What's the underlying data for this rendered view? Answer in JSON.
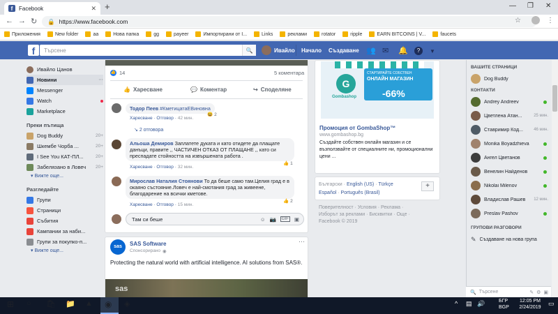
{
  "browser": {
    "tab_title": "Facebook",
    "url": "https://www.facebook.com",
    "bookmarks": [
      "Приложения",
      "New folder",
      "аа",
      "Нова папка",
      "gg",
      "payeer",
      "Импортирани от I...",
      "Links",
      "реклами",
      "rotator",
      "ripple",
      "EARN BITCOINS | V...",
      "faucets"
    ]
  },
  "fb": {
    "search_placeholder": "Търсене",
    "user_name": "Ивайло",
    "home": "Начало",
    "create": "Създаване"
  },
  "left": {
    "profile": "Ивайло Цанов",
    "main_items": [
      {
        "label": "Новини",
        "color": "#4267b2"
      },
      {
        "label": "Messenger",
        "color": "#0084ff"
      },
      {
        "label": "Watch",
        "color": "#3578e5"
      },
      {
        "label": "Marketplace",
        "color": "#1ba39c"
      }
    ],
    "shortcuts_title": "Преки пътища",
    "shortcuts": [
      {
        "label": "Dog Buddy",
        "count": "20+"
      },
      {
        "label": "Шкембе Чорба ...",
        "count": "20+"
      },
      {
        "label": "I See You КАТ-ПЛ...",
        "count": "20+"
      },
      {
        "label": "Забелязано в Ловеч",
        "count": "20+"
      }
    ],
    "more1": "Вижте още...",
    "explore_title": "Разгледайте",
    "explore": [
      {
        "label": "Групи",
        "color": "#3578e5"
      },
      {
        "label": "Страници",
        "color": "#f7533e"
      },
      {
        "label": "Събития",
        "color": "#e9443a"
      },
      {
        "label": "Кампании за наби...",
        "color": "#e9443a"
      },
      {
        "label": "Групи за покупко-п...",
        "color": "#8a8d91"
      }
    ],
    "more2": "Вижте още..."
  },
  "post": {
    "likes": "14",
    "comments_count": "5 коментара",
    "like_btn": "Харесване",
    "comment_btn": "Коментар",
    "share_btn": "Споделяне",
    "comments": [
      {
        "author": "Тодор Пеев",
        "text": "#КметицатаЕВиновна",
        "react_count": "2",
        "like": "Харесване",
        "reply": "Отговор",
        "time": "42 мин.",
        "replies": "2 отговора"
      },
      {
        "author": "Альоша Демиров",
        "text": "Заплатете дуката и като отидете да плащате данъци, правите ,, ЧАСТИЧЕН ОТКАЗ ОТ ПЛАЩАНЕ ,, като си преспадате стойността на извършената работа .",
        "react_count": "1",
        "like": "Харесване",
        "reply": "Отговор",
        "time": "32 мин."
      },
      {
        "author": "Мирослав Наталия Стоянови",
        "text": "То да беше само там.Целия град е в окаяно състояние.Ловеч е най-смотания град за живеене, благодарение на всички кметове.",
        "react_count": "2",
        "like": "Харесване",
        "reply": "Отговор",
        "time": "15 мин."
      }
    ],
    "comment_input": "Там си беше"
  },
  "sponsored": {
    "name": "SAS Software",
    "label": "Спонсорирано",
    "text": "Protecting the natural world with artificial intelligence. AI solutions from SAS®.",
    "logo": "sas"
  },
  "ad": {
    "title": "Промоция от GombaShop™",
    "domain": "www.gombashop.bg",
    "desc": "Създайте собствен онлайн магазин и се възползвайте от специалните ни, промоционални цени ...",
    "banner_top": "СТАРТИРАЙТЕ СОБСТВЕН",
    "banner_main": "ОНЛАЙН МАГАЗИН",
    "banner_discount": "-66%",
    "banner_brand": "Gombashop"
  },
  "langs": {
    "items": [
      "Български",
      "English (US)",
      "Türkçe",
      "Español",
      "Português (Brasil)"
    ]
  },
  "footer": {
    "line1": "Поверителност · Условия · Реклама ·",
    "line2": "Изборът за реклами · Бисквитки · Още ·",
    "line3": "Facebook © 2019"
  },
  "chat": {
    "your_pages": "ВАШИТЕ СТРАНИЦИ",
    "page": "Dog Buddy",
    "contacts": "КОНТАКТИ",
    "people": [
      {
        "name": "Andrey Andreev",
        "status": "online"
      },
      {
        "name": "Цветлена Атан...",
        "status": "25 мин."
      },
      {
        "name": "Ставримир Код...",
        "status": "46 мин."
      },
      {
        "name": "Monika Boyadzhieva",
        "status": "online"
      },
      {
        "name": "Ангел Цветанов",
        "status": "online"
      },
      {
        "name": "Венелин Найденов",
        "status": "online"
      },
      {
        "name": "Nikolai Milenov",
        "status": "online"
      },
      {
        "name": "Владислав Рашев",
        "status": "12 мин."
      },
      {
        "name": "Preslav Pashov",
        "status": "online"
      }
    ],
    "group_title": "ГРУПОВИ РАЗГОВОРИ",
    "new_group": "Създаване на нова група",
    "search": "Търсене"
  },
  "taskbar": {
    "lang1": "БГР",
    "lang2": "BGP",
    "time": "12:05 PM",
    "date": "2/24/2019"
  }
}
